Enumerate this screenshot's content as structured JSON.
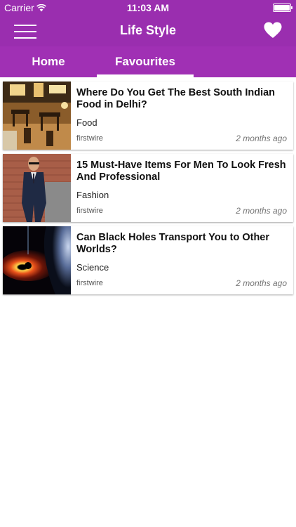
{
  "status_bar": {
    "carrier": "Carrier",
    "time": "11:03 AM",
    "wifi_icon": "wifi-icon",
    "battery_icon": "battery-icon"
  },
  "nav": {
    "title": "Life Style",
    "menu_icon": "hamburger-menu-icon",
    "favourite_icon": "heart-icon"
  },
  "tabs": [
    {
      "label": "Home",
      "active": false
    },
    {
      "label": "Favourites",
      "active": true
    }
  ],
  "colors": {
    "primary": "#a030b4",
    "primary_dark": "#9a2eaf",
    "tab_indicator": "#ffffff"
  },
  "articles": [
    {
      "title": "Where Do You Get The Best South Indian Food in Delhi?",
      "category": "Food",
      "source": "firstwire",
      "time": "2 months ago",
      "thumbnail": "restaurant-interior-image"
    },
    {
      "title": "15 Must-Have Items For Men To Look Fresh And Professional",
      "category": "Fashion",
      "source": "firstwire",
      "time": "2 months ago",
      "thumbnail": "man-in-suit-image"
    },
    {
      "title": "Can Black Holes Transport You to Other Worlds?",
      "category": "Science",
      "source": "firstwire",
      "time": "2 months ago",
      "thumbnail": "black-hole-image"
    }
  ]
}
